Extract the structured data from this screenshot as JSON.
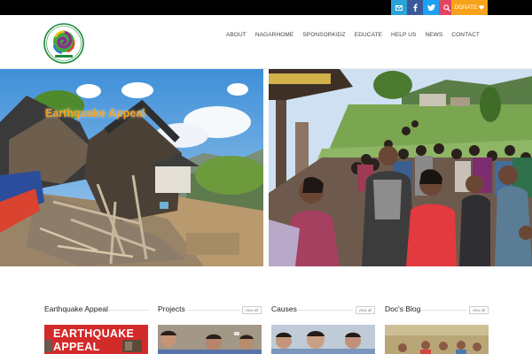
{
  "topbar": {
    "social": [
      {
        "name": "email",
        "icon": "envelope-icon",
        "color": "#2aa3d9"
      },
      {
        "name": "facebook",
        "icon": "facebook-icon",
        "color": "#3b5998"
      },
      {
        "name": "twitter",
        "icon": "twitter-icon",
        "color": "#1da1f2"
      },
      {
        "name": "search",
        "icon": "search-icon",
        "color": "#e0445e"
      }
    ],
    "donate_label": "DONATE",
    "donate_color": "#f7a21b"
  },
  "header": {
    "logo_icon": "nagarkot-swirl-logo",
    "nav": [
      "ABOUT",
      "NAGARHOME",
      "SPONSORKIDZ",
      "EDUCATE",
      "HELP US",
      "NEWS",
      "CONTACT"
    ]
  },
  "hero": {
    "caption": "Earthquake Appeal"
  },
  "columns": {
    "titles": [
      "Earthquake Appeal",
      "Projects",
      "Causes",
      "Doc's Blog"
    ],
    "view_all": "view all",
    "banner_line1": "EARTHQUAKE",
    "banner_line2": "APPEAL"
  }
}
